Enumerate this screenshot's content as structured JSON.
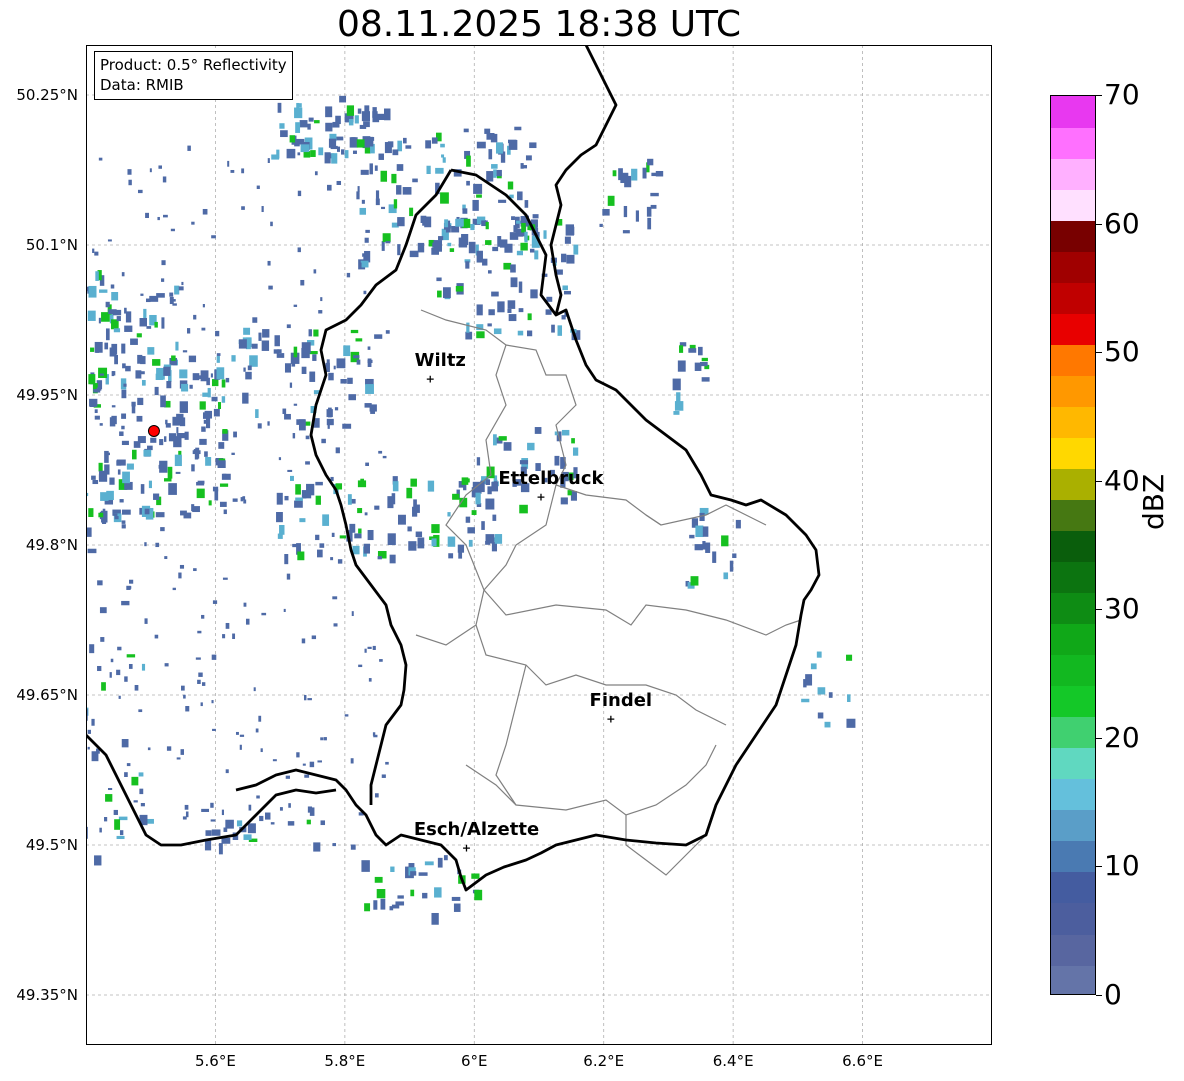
{
  "title": "08.11.2025 18:38 UTC",
  "info_box": {
    "product": "Product: 0.5° Reflectivity",
    "data": "Data: RMIB"
  },
  "axes": {
    "lat_range": [
      49.3,
      50.3
    ],
    "lon_range": [
      5.4,
      6.8
    ],
    "lat_ticks": [
      {
        "value": 49.35,
        "label": "49.35°N"
      },
      {
        "value": 49.5,
        "label": "49.5°N"
      },
      {
        "value": 49.65,
        "label": "49.65°N"
      },
      {
        "value": 49.8,
        "label": "49.8°N"
      },
      {
        "value": 49.95,
        "label": "49.95°N"
      },
      {
        "value": 50.1,
        "label": "50.1°N"
      },
      {
        "value": 50.25,
        "label": "50.25°N"
      }
    ],
    "lon_ticks": [
      {
        "value": 5.6,
        "label": "5.6°E"
      },
      {
        "value": 5.8,
        "label": "5.8°E"
      },
      {
        "value": 6.0,
        "label": "6°E"
      },
      {
        "value": 6.2,
        "label": "6.2°E"
      },
      {
        "value": 6.4,
        "label": "6.4°E"
      },
      {
        "value": 6.6,
        "label": "6.6°E"
      }
    ],
    "grid": true
  },
  "cities": [
    {
      "name": "Wiltz",
      "lon": 5.932,
      "lat": 49.966
    },
    {
      "name": "Ettelbruck",
      "lon": 6.103,
      "lat": 49.848
    },
    {
      "name": "Findel",
      "lon": 6.211,
      "lat": 49.626
    },
    {
      "name": "Esch/Alzette",
      "lon": 5.988,
      "lat": 49.497
    }
  ],
  "radar_site": {
    "lon": 5.505,
    "lat": 49.914,
    "color": "#ff0000"
  },
  "colorbar": {
    "label": "dBZ",
    "min": 0,
    "max": 70,
    "ticks": [
      0,
      10,
      20,
      30,
      40,
      50,
      60,
      70
    ],
    "colors": [
      "#6474a8",
      "#5866a0",
      "#4c5e9e",
      "#445ca0",
      "#4a7ab2",
      "#5a9ec8",
      "#64c0dc",
      "#60d8c0",
      "#40d070",
      "#14c828",
      "#12b820",
      "#10a818",
      "#0e8c14",
      "#0c7410",
      "#0a5e0c",
      "#467812",
      "#aab000",
      "#ffd800",
      "#ffb800",
      "#ff9800",
      "#ff7800",
      "#e80000",
      "#c00000",
      "#a00000",
      "#780000",
      "#ffe0ff",
      "#ffb0ff",
      "#ff70ff",
      "#e838f0"
    ]
  },
  "colors": {
    "border": "#000000",
    "canton": "#808080",
    "grid": "#b0b0b0",
    "echo_light": "#4e6aa6",
    "echo_mid": "#5ab0d0",
    "echo_strong": "#16c020"
  }
}
